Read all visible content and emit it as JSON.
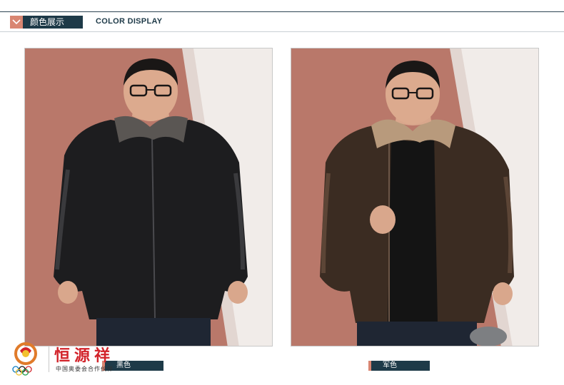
{
  "header": {
    "section_title": "颜色展示",
    "section_subtitle": "COLOR DISPLAY"
  },
  "products": [
    {
      "color_name": "黑色",
      "jacket_hex": "#1d1d1f"
    },
    {
      "color_name": "军色",
      "jacket_hex": "#3b2c22"
    }
  ],
  "watermark": {
    "brand": "恒源祥",
    "subtitle": "中国奥委会合作伙伴"
  },
  "colors": {
    "accent": "#d98672",
    "navy": "#1e3a48",
    "backdrop": "#b9786a",
    "brand_red": "#d2232a"
  },
  "icons": [
    "chevron-down-icon",
    "olympic-rings-icon"
  ]
}
